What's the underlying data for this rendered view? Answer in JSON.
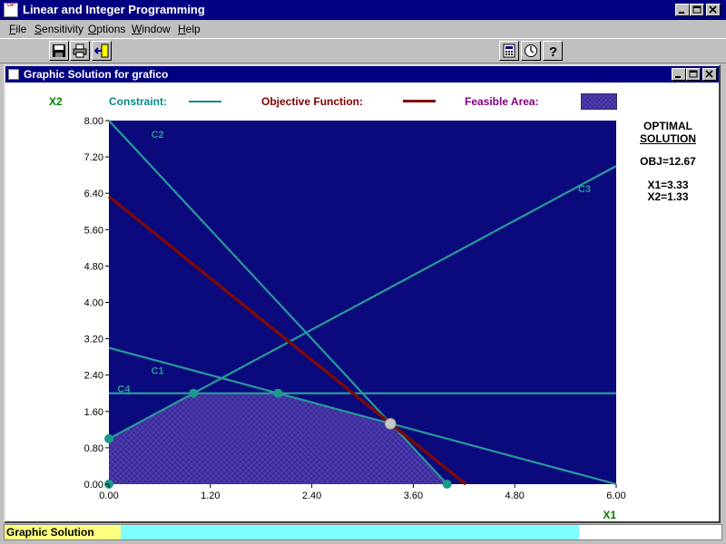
{
  "app": {
    "title": "Linear and Integer Programming",
    "icon_text": "LIP"
  },
  "menu": [
    "File",
    "Sensitivity",
    "Options",
    "Window",
    "Help"
  ],
  "toolbar": {
    "left_buttons": [
      "save-icon",
      "print-icon",
      "exit-icon"
    ],
    "right_buttons": [
      "calculator-icon",
      "clock-icon",
      "help-icon"
    ]
  },
  "child_window": {
    "title": "Graphic Solution for grafico"
  },
  "legend": {
    "y_axis_label": "X2",
    "constraint_label": "Constraint:",
    "objective_label": "Objective Function:",
    "feasible_label": "Feasible Area:"
  },
  "solution": {
    "heading_line1": "OPTIMAL",
    "heading_line2": "SOLUTION",
    "obj": "OBJ=12.67",
    "x1": "X1=3.33",
    "x2": "X2=1.33"
  },
  "status": {
    "label": "Graphic Solution"
  },
  "colors": {
    "plot_bg": "#0a0a7c",
    "constraint": "#2a9a9a",
    "objective": "#7a0a0a",
    "feasible": "#3a2a9a",
    "axis_label_green": "#008000",
    "legend_teal": "#108888",
    "legend_maroon": "#800000",
    "legend_purple": "#800080"
  },
  "chart_data": {
    "type": "line",
    "xlabel": "X1",
    "ylabel": "X2",
    "xlim": [
      0,
      6
    ],
    "ylim": [
      0,
      8
    ],
    "x_ticks": [
      "0.00",
      "1.20",
      "2.40",
      "3.60",
      "4.80",
      "6.00"
    ],
    "y_ticks": [
      "0.00",
      "0.80",
      "1.60",
      "2.40",
      "3.20",
      "4.00",
      "4.80",
      "5.60",
      "6.40",
      "7.20",
      "8.00"
    ],
    "constraints": [
      {
        "name": "C1",
        "points": [
          [
            0,
            3
          ],
          [
            6,
            0
          ]
        ]
      },
      {
        "name": "C2",
        "points": [
          [
            0,
            8
          ],
          [
            4,
            0
          ]
        ]
      },
      {
        "name": "C3",
        "points": [
          [
            0,
            1
          ],
          [
            6,
            7
          ]
        ]
      },
      {
        "name": "C4",
        "points": [
          [
            0,
            2
          ],
          [
            6,
            2
          ]
        ]
      }
    ],
    "objective": {
      "points": [
        [
          0,
          6.33
        ],
        [
          4.22,
          0
        ]
      ]
    },
    "feasible_region": [
      [
        0,
        0
      ],
      [
        0,
        1
      ],
      [
        1,
        2
      ],
      [
        2,
        2
      ],
      [
        3.33,
        1.33
      ],
      [
        4,
        0
      ]
    ],
    "vertices": [
      [
        0,
        0
      ],
      [
        0,
        1
      ],
      [
        1,
        2
      ],
      [
        2,
        2
      ],
      [
        4,
        0
      ]
    ],
    "optimal_point": [
      3.33,
      1.33
    ],
    "grid": false
  }
}
